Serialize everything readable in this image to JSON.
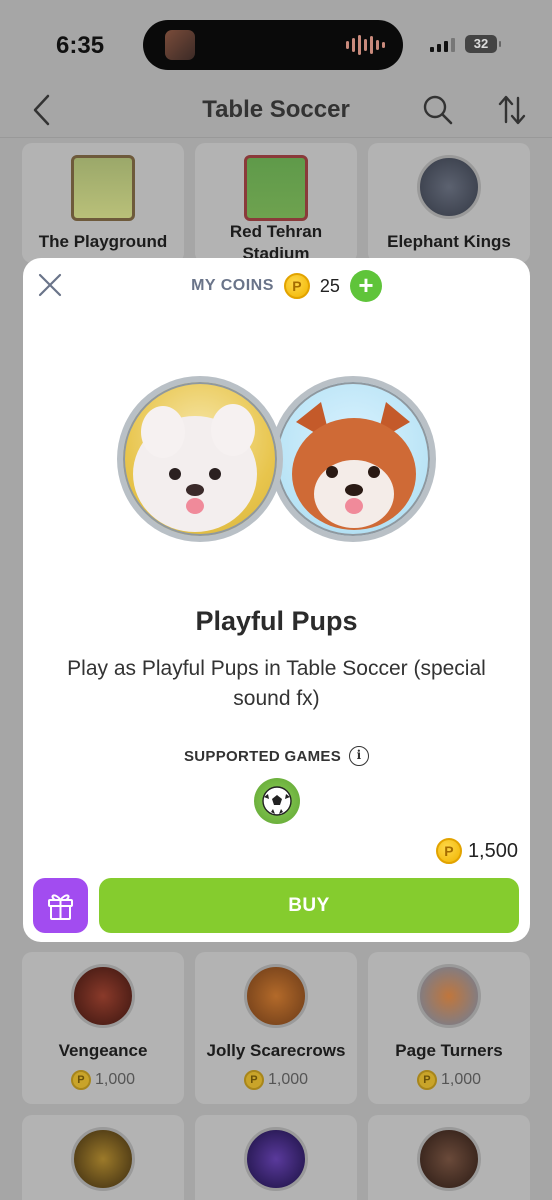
{
  "status_bar": {
    "time": "6:35",
    "battery": "32"
  },
  "nav": {
    "title": "Table Soccer"
  },
  "top_cards": [
    {
      "name": "The Playground"
    },
    {
      "name": "Red Tehran Stadium"
    },
    {
      "name": "Elephant Kings"
    }
  ],
  "modal": {
    "my_coins_label": "MY COINS",
    "coin_glyph": "P",
    "coin_count": "25",
    "add_label": "+",
    "item_title": "Playful Pups",
    "item_description": "Play as Playful Pups in Table Soccer (special sound fx)",
    "supported_label": "SUPPORTED GAMES",
    "info_glyph": "i",
    "price": "1,500",
    "buy_label": "BUY"
  },
  "bottom_cards": [
    {
      "name": "Vengeance",
      "price": "1,000"
    },
    {
      "name": "Jolly Scarecrows",
      "price": "1,000"
    },
    {
      "name": "Page Turners",
      "price": "1,000"
    }
  ],
  "colors": {
    "buy": "#85cc2e",
    "gift": "#a24cf0",
    "add": "#5fc43a",
    "coin": "#f0b400"
  }
}
